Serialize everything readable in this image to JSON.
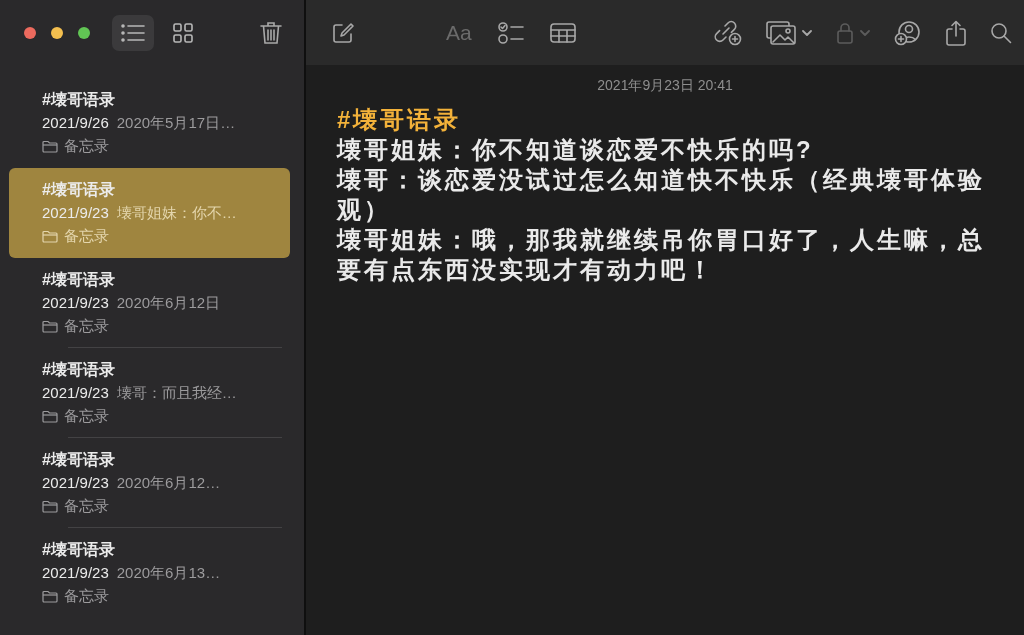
{
  "window_controls": [
    {
      "color": "#ec6a5e"
    },
    {
      "color": "#f4bf4f"
    },
    {
      "color": "#61c554"
    }
  ],
  "sidebar": {
    "view_buttons": [
      {
        "kind": "list",
        "selected": true
      },
      {
        "kind": "gallery",
        "selected": false
      }
    ],
    "notes": [
      {
        "title": "#壊哥语录",
        "date": "2021/9/26",
        "snippet": "2020年5月17日…",
        "folder": "备忘录",
        "selected": false
      },
      {
        "title": "#壊哥语录",
        "date": "2021/9/23",
        "snippet": "壊哥姐妹：你不…",
        "folder": "备忘录",
        "selected": true
      },
      {
        "title": "#壊哥语录",
        "date": "2021/9/23",
        "snippet": "2020年6月12日",
        "folder": "备忘录",
        "selected": false
      },
      {
        "title": "#壊哥语录",
        "date": "2021/9/23",
        "snippet": "壊哥：而且我经…",
        "folder": "备忘录",
        "selected": false
      },
      {
        "title": "#壊哥语录",
        "date": "2021/9/23",
        "snippet": "2020年6月12…",
        "folder": "备忘录",
        "selected": false
      },
      {
        "title": "#壊哥语录",
        "date": "2021/9/23",
        "snippet": "2020年6月13…",
        "folder": "备忘录",
        "selected": false
      }
    ]
  },
  "toolbar": {
    "buttons": [
      {
        "kind": "compose",
        "disabled": false
      },
      {
        "kind": "format",
        "label": "Aa",
        "disabled": true
      },
      {
        "kind": "checklist",
        "disabled": false
      },
      {
        "kind": "table",
        "disabled": false
      },
      {
        "kind": "link",
        "disabled": false
      },
      {
        "kind": "media",
        "disabled": false,
        "menu": true
      },
      {
        "kind": "lock",
        "disabled": true,
        "menu": true
      },
      {
        "kind": "people",
        "disabled": false
      },
      {
        "kind": "share",
        "disabled": false
      },
      {
        "kind": "search",
        "disabled": false
      }
    ]
  },
  "editor": {
    "timestamp": "2021年9月23日 20:41",
    "title": "#壊哥语录",
    "paragraphs": [
      "壊哥姐妹：你不知道谈恋爱不快乐的吗?",
      "壊哥：谈恋爱没试过怎么知道快不快乐（经典壊哥体验观）",
      "壊哥姐妹：哦，那我就继续吊你胃口好了，人生嘛，总要有点东西没实现才有动力吧！"
    ]
  }
}
